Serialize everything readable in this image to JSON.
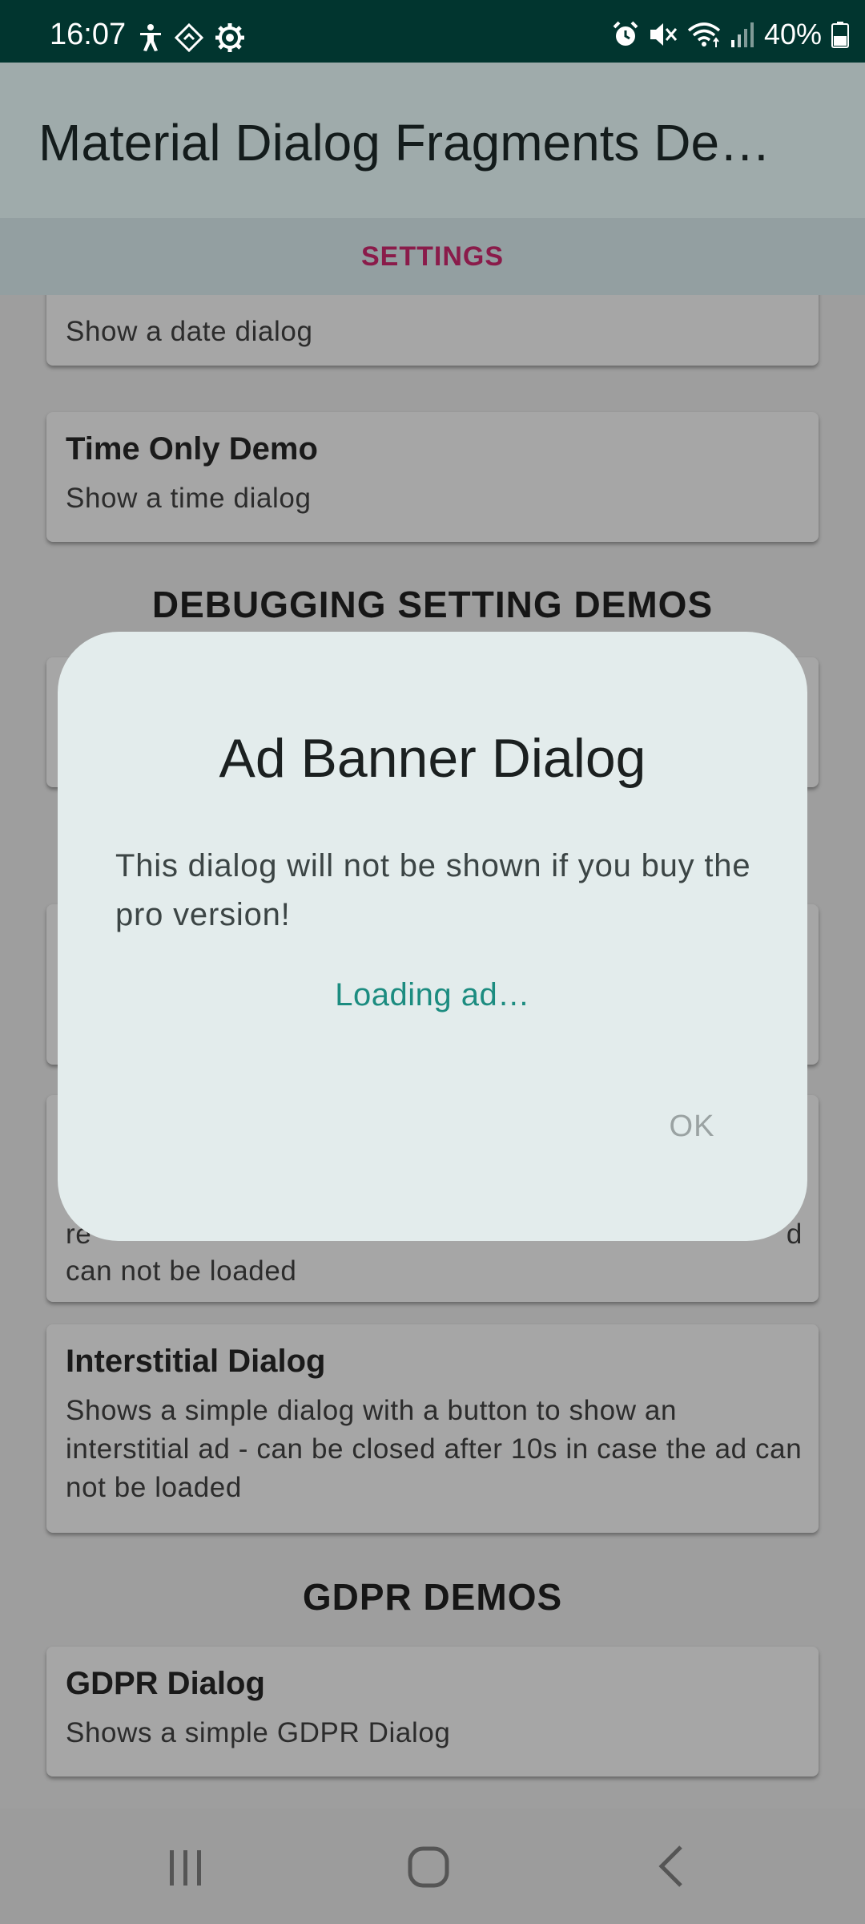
{
  "status_bar": {
    "time": "16:07",
    "left_icons": [
      "accessibility-icon",
      "diamond-nav-icon",
      "gear-icon"
    ],
    "right_icons": [
      "alarm-icon",
      "mute-icon",
      "wifi-icon",
      "signal-icon"
    ],
    "battery": "40%",
    "background": "#01352f"
  },
  "app_bar": {
    "title": "Material Dialog Fragments De…"
  },
  "tabs": {
    "active_label": "SETTINGS",
    "active_color": "#8a1b4a"
  },
  "content": {
    "cards": [
      {
        "title": "",
        "subtitle": "Show a date dialog"
      },
      {
        "title": "Time Only Demo",
        "subtitle": "Show a time dialog"
      },
      {
        "title": "",
        "subtitle": ""
      },
      {
        "title": "",
        "subtitle": ""
      },
      {
        "title": "",
        "subtitle_partial_prefix": "re",
        "subtitle_partial_suffix": "d",
        "subtitle_last_line": "can not be loaded"
      },
      {
        "title": "Interstitial Dialog",
        "subtitle": "Shows a simple dialog with a button to show an interstitial ad - can be closed after 10s in case the ad can not be loaded"
      },
      {
        "title": "GDPR Dialog",
        "subtitle": "Shows a simple GDPR Dialog"
      }
    ],
    "sections": {
      "debugging": "DEBUGGING SETTING DEMOS",
      "gdpr": "GDPR DEMOS"
    }
  },
  "dialog": {
    "title": "Ad Banner Dialog",
    "message": "This dialog will not be shown if you buy the pro version!",
    "loading": "Loading ad…",
    "ok_label": "OK",
    "accent_color": "#1c8c80"
  },
  "nav_bar": {
    "buttons": [
      "recents-icon",
      "home-icon",
      "back-icon"
    ]
  }
}
